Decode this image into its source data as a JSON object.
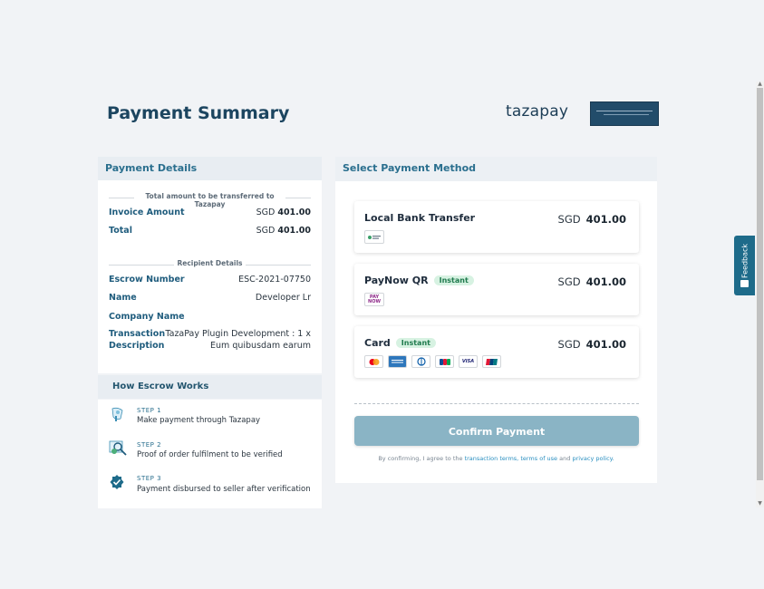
{
  "header": {
    "title": "Payment Summary",
    "brand": "tazapay"
  },
  "payment_details": {
    "heading": "Payment Details",
    "total_section_label": "Total amount to be transferred to Tazapay",
    "invoice_amount": {
      "label": "Invoice Amount",
      "currency": "SGD",
      "amount": "401.00"
    },
    "total": {
      "label": "Total",
      "currency": "SGD",
      "amount": "401.00"
    },
    "recipient_section_label": "Recipient Details",
    "escrow_number": {
      "label": "Escrow Number",
      "value": "ESC-2021-07750"
    },
    "name": {
      "label": "Name",
      "value": "Developer Lr"
    },
    "company_name": {
      "label": "Company Name",
      "value": ""
    },
    "transaction_description": {
      "label_line1": "Transaction",
      "label_line2": "Description",
      "value_line1": "TazaPay Plugin Development : 1 x",
      "value_line2": "Eum quibusdam earum"
    }
  },
  "escrow": {
    "heading": "How Escrow Works",
    "steps": [
      {
        "label": "STEP 1",
        "text": "Make payment through Tazapay",
        "icon": "payment-icon"
      },
      {
        "label": "STEP 2",
        "text": "Proof of order fulfilment to be verified",
        "icon": "verify-search-icon"
      },
      {
        "label": "STEP 3",
        "text": "Payment disbursed to seller after verification",
        "icon": "check-badge-icon"
      }
    ]
  },
  "payment_method": {
    "heading": "Select Payment Method",
    "methods": [
      {
        "name": "Local Bank Transfer",
        "badge": "",
        "currency": "SGD",
        "amount": "401.00"
      },
      {
        "name": "PayNow QR",
        "badge": "Instant",
        "currency": "SGD",
        "amount": "401.00",
        "logo_text": "PAY NOW"
      },
      {
        "name": "Card",
        "badge": "Instant",
        "currency": "SGD",
        "amount": "401.00",
        "card_icons": [
          "mastercard-icon",
          "amex-icon",
          "diners-icon",
          "jcb-icon",
          "visa-icon",
          "unionpay-icon"
        ],
        "visa_text": "VISA"
      }
    ],
    "confirm_label": "Confirm Payment",
    "terms": {
      "prefix": "By confirming, I agree to the",
      "link1": "transaction terms,",
      "link2": "terms of use",
      "and": "and",
      "link3": "privacy policy."
    }
  },
  "feedback": {
    "label": "Feedback"
  },
  "colors": {
    "primary": "#1e6b8a",
    "button_disabled": "#8ab4c5",
    "instant_badge_bg": "#d7f2e2",
    "instant_badge_text": "#1f7a4d"
  }
}
